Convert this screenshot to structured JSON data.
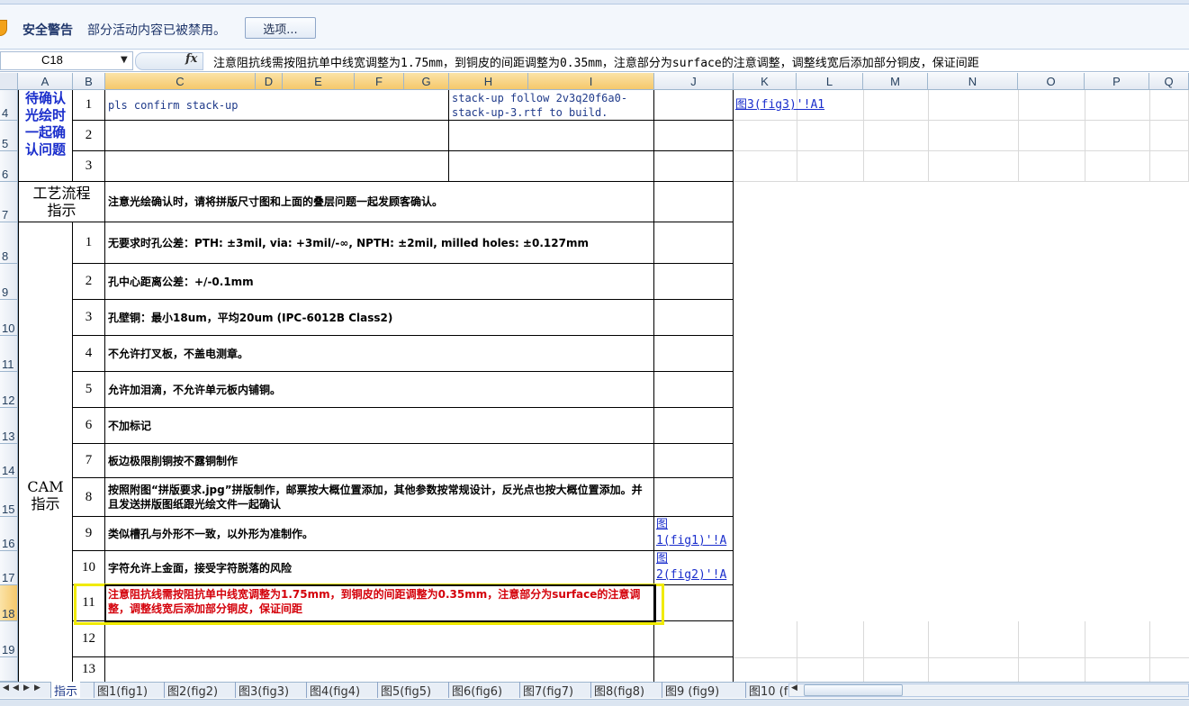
{
  "security": {
    "title": "安全警告",
    "message": "部分活动内容已被禁用。",
    "options_label": "选项..."
  },
  "formula_bar": {
    "name_box": "C18",
    "fx": "fx",
    "content": "注意阻抗线需按阻抗单中线宽调整为1.75mm，到铜皮的间距调整为0.35mm，注意部分为surface的注意调整，调整线宽后添加部分铜皮，保证间距"
  },
  "columns": [
    "A",
    "B",
    "C",
    "D",
    "E",
    "F",
    "G",
    "H",
    "I",
    "J",
    "K",
    "L",
    "M",
    "N",
    "O",
    "P",
    "Q"
  ],
  "row_numbers": [
    "4",
    "5",
    "6",
    "7",
    "8",
    "9",
    "10",
    "11",
    "12",
    "13",
    "14",
    "15",
    "16",
    "17",
    "18",
    "19"
  ],
  "sheet": {
    "pending_label": "待确认光绘时一起确认问题",
    "pending_lines": [
      "待确认",
      "光绘时",
      "一起确",
      "认问题"
    ],
    "pending_rows": [
      {
        "no": "1",
        "c": "pls confirm stack-up",
        "h": "stack-up follow 2v3q20f6a0-stack-up-3.rtf  to build."
      },
      {
        "no": "2",
        "c": "",
        "h": ""
      },
      {
        "no": "3",
        "c": "",
        "h": ""
      }
    ],
    "process_label_lines": [
      "工艺流程",
      "指示"
    ],
    "process_text": "注意光绘确认时，请将拼版尺寸图和上面的叠层问题一起发顾客确认。",
    "cam_label_lines": [
      "CAM",
      "指示"
    ],
    "cam_rows": [
      {
        "no": "1",
        "text": "无要求时孔公差：PTH: ±3mil, via: +3mil/-∞, NPTH: ±2mil, milled holes: ±0.127mm",
        "j": ""
      },
      {
        "no": "2",
        "text": "孔中心距离公差：+/-0.1mm",
        "j": ""
      },
      {
        "no": "3",
        "text": "孔壁铜：最小18um，平均20um (IPC-6012B Class2)",
        "j": ""
      },
      {
        "no": "4",
        "text": "不允许打叉板，不盖电测章。",
        "j": ""
      },
      {
        "no": "5",
        "text": "允许加泪滴，不允许单元板内铺铜。",
        "j": ""
      },
      {
        "no": "6",
        "text": "不加标记",
        "j": ""
      },
      {
        "no": "7",
        "text": "板边极限削铜按不露铜制作",
        "j": ""
      },
      {
        "no": "8",
        "text": "按照附图“拼版要求.jpg”拼版制作，邮票按大概位置添加，其他参数按常规设计，反光点也按大概位置添加。并且发送拼版图纸跟光绘文件一起确认",
        "j": ""
      },
      {
        "no": "9",
        "text": "类似槽孔与外形不一致，以外形为准制作。",
        "j": "图1(fig1)'!A"
      },
      {
        "no": "10",
        "text": "字符允许上金面，接受字符脱落的风险",
        "j": "图2(fig2)'!A"
      },
      {
        "no": "11",
        "text": "注意阻抗线需按阻抗单中线宽调整为1.75mm，到铜皮的间距调整为0.35mm，注意部分为surface的注意调整，调整线宽后添加部分铜皮，保证间距",
        "j": ""
      },
      {
        "no": "12",
        "text": "",
        "j": ""
      },
      {
        "no": "13",
        "text": "",
        "j": ""
      }
    ],
    "k4_link": "图3(fig3)'!A1",
    "j16_lines": [
      "图",
      "1(fig1)'!A"
    ],
    "j17_lines": [
      "图",
      "2(fig2)'!A"
    ]
  },
  "tabs": [
    "指示",
    "图1(fig1)",
    "图2(fig2)",
    "图3(fig3)",
    "图4(fig4)",
    "图5(fig5)",
    "图6(fig6)",
    "图7(fig7)",
    "图8(fig8)",
    "图9 (fig9)",
    "图10 (f"
  ],
  "active_tab": "指示",
  "colors": {
    "accent_yellow": "#f0ea00",
    "link_blue": "#1a2ecc",
    "alert_red": "#d4000a"
  }
}
